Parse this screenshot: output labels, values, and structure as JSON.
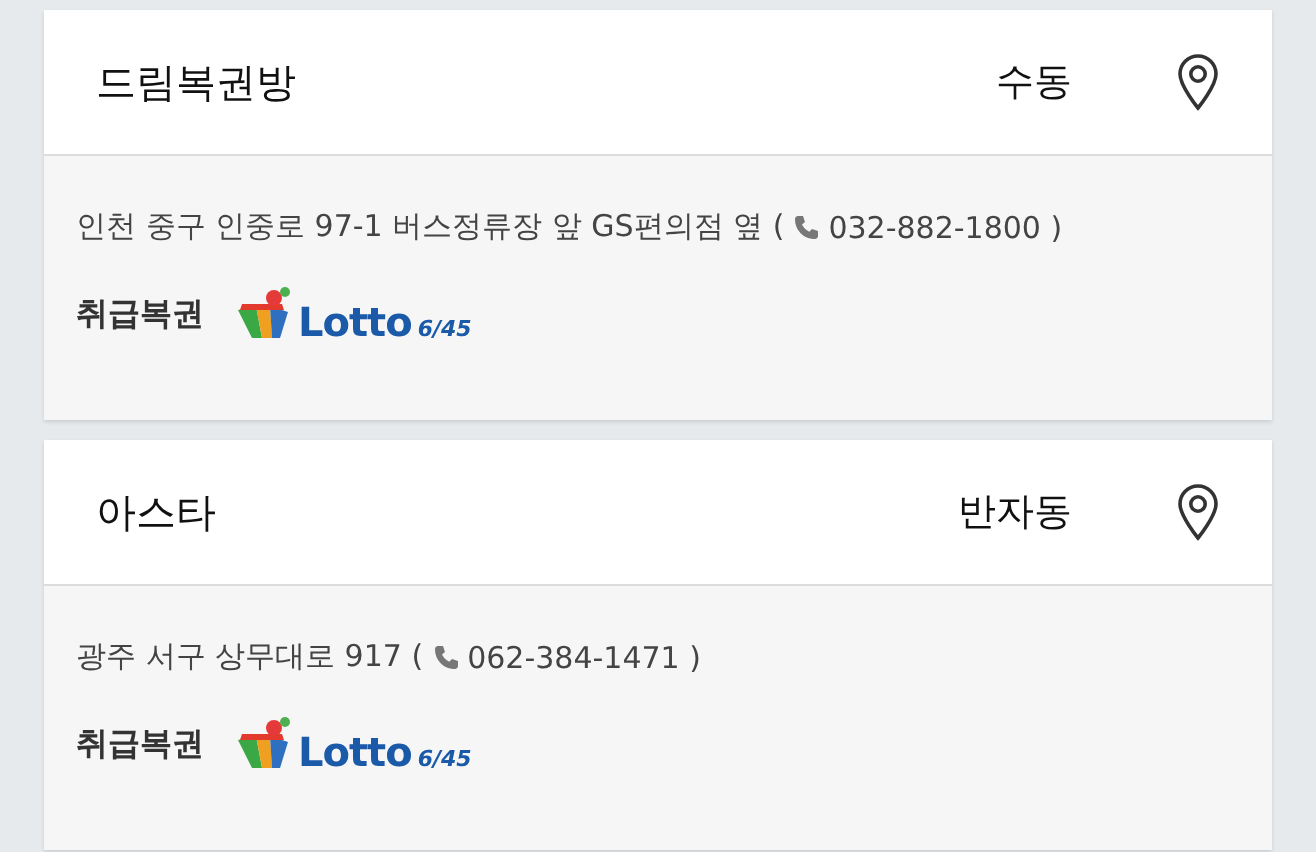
{
  "stores": [
    {
      "name": "드림복권방",
      "area": "수동",
      "address": "인천 중구 인중로 97-1 버스정류장 앞 GS편의점 옆 (",
      "phone": "032-882-1800 )",
      "games_label": "취급복권",
      "games": [
        {
          "logo": "Lotto",
          "sub": "6/45"
        }
      ]
    },
    {
      "name": "아스타",
      "area": "반자동",
      "address": "광주 서구 상무대로 917 (",
      "phone": "062-384-1471 )",
      "games_label": "취급복권",
      "games": [
        {
          "logo": "Lotto",
          "sub": "6/45"
        }
      ]
    }
  ]
}
